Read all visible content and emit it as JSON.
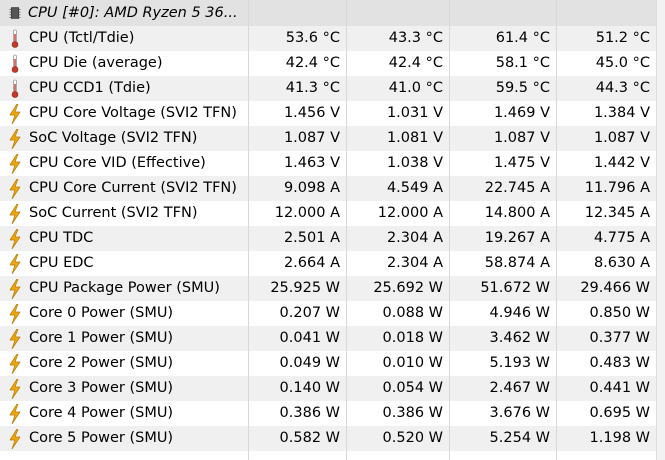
{
  "group": {
    "label": "CPU [#0]: AMD Ryzen 5 36...",
    "icon": "chip-icon"
  },
  "rows": [
    {
      "name": "CPU (Tctl/Tdie)",
      "icon": "thermometer-icon",
      "current": "53.6 °C",
      "min": "43.3 °C",
      "max": "61.4 °C",
      "avg": "51.2 °C"
    },
    {
      "name": "CPU Die (average)",
      "icon": "thermometer-icon",
      "current": "42.4 °C",
      "min": "42.4 °C",
      "max": "58.1 °C",
      "avg": "45.0 °C"
    },
    {
      "name": "CPU CCD1 (Tdie)",
      "icon": "thermometer-icon",
      "current": "41.3 °C",
      "min": "41.0 °C",
      "max": "59.5 °C",
      "avg": "44.3 °C"
    },
    {
      "name": "CPU Core Voltage (SVI2 TFN)",
      "icon": "lightning-icon",
      "current": "1.456 V",
      "min": "1.031 V",
      "max": "1.469 V",
      "avg": "1.384 V"
    },
    {
      "name": "SoC Voltage (SVI2 TFN)",
      "icon": "lightning-icon",
      "current": "1.087 V",
      "min": "1.081 V",
      "max": "1.087 V",
      "avg": "1.087 V"
    },
    {
      "name": "CPU Core VID (Effective)",
      "icon": "lightning-icon",
      "current": "1.463 V",
      "min": "1.038 V",
      "max": "1.475 V",
      "avg": "1.442 V"
    },
    {
      "name": "CPU Core Current (SVI2 TFN)",
      "icon": "lightning-icon",
      "current": "9.098 A",
      "min": "4.549 A",
      "max": "22.745 A",
      "avg": "11.796 A"
    },
    {
      "name": "SoC Current (SVI2 TFN)",
      "icon": "lightning-icon",
      "current": "12.000 A",
      "min": "12.000 A",
      "max": "14.800 A",
      "avg": "12.345 A"
    },
    {
      "name": "CPU TDC",
      "icon": "lightning-icon",
      "current": "2.501 A",
      "min": "2.304 A",
      "max": "19.267 A",
      "avg": "4.775 A"
    },
    {
      "name": "CPU EDC",
      "icon": "lightning-icon",
      "current": "2.664 A",
      "min": "2.304 A",
      "max": "58.874 A",
      "avg": "8.630 A"
    },
    {
      "name": "CPU Package Power (SMU)",
      "icon": "lightning-icon",
      "current": "25.925 W",
      "min": "25.692 W",
      "max": "51.672 W",
      "avg": "29.466 W"
    },
    {
      "name": "Core 0 Power (SMU)",
      "icon": "lightning-icon",
      "current": "0.207 W",
      "min": "0.088 W",
      "max": "4.946 W",
      "avg": "0.850 W"
    },
    {
      "name": "Core 1 Power (SMU)",
      "icon": "lightning-icon",
      "current": "0.041 W",
      "min": "0.018 W",
      "max": "3.462 W",
      "avg": "0.377 W"
    },
    {
      "name": "Core 2 Power (SMU)",
      "icon": "lightning-icon",
      "current": "0.049 W",
      "min": "0.010 W",
      "max": "5.193 W",
      "avg": "0.483 W"
    },
    {
      "name": "Core 3 Power (SMU)",
      "icon": "lightning-icon",
      "current": "0.140 W",
      "min": "0.054 W",
      "max": "2.467 W",
      "avg": "0.441 W"
    },
    {
      "name": "Core 4 Power (SMU)",
      "icon": "lightning-icon",
      "current": "0.386 W",
      "min": "0.386 W",
      "max": "3.676 W",
      "avg": "0.695 W"
    },
    {
      "name": "Core 5 Power (SMU)",
      "icon": "lightning-icon",
      "current": "0.582 W",
      "min": "0.520 W",
      "max": "5.254 W",
      "avg": "1.198 W"
    }
  ],
  "colors": {
    "thermometer": "#c0392b",
    "lightning": "#f0a810",
    "lightning_outline": "#b87800",
    "chip": "#555555"
  }
}
